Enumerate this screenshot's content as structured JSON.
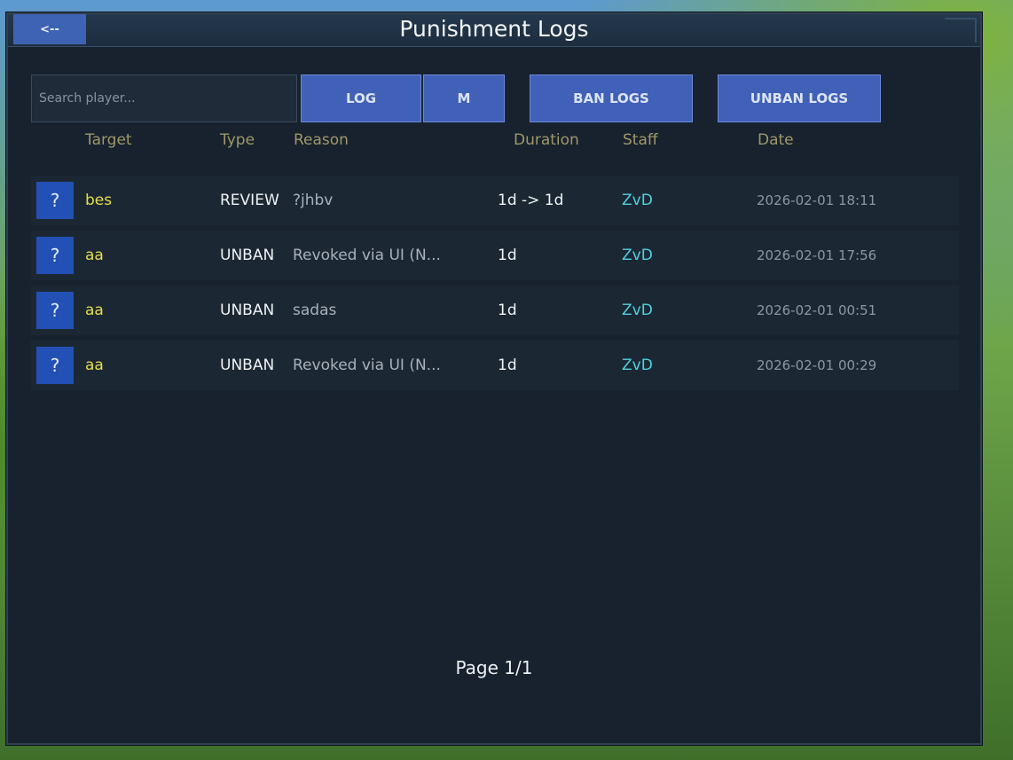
{
  "window": {
    "title": "Punishment Logs",
    "back_label": "<--"
  },
  "toolbar": {
    "search_placeholder": "Search player...",
    "log_label": "LOG",
    "m_label": "M",
    "ban_logs_label": "BAN LOGS",
    "unban_logs_label": "UNBAN LOGS"
  },
  "table": {
    "headers": {
      "target": "Target",
      "type": "Type",
      "reason": "Reason",
      "duration": "Duration",
      "staff": "Staff",
      "date": "Date"
    },
    "rows": [
      {
        "icon": "?",
        "target": "bes",
        "type": "REVIEW",
        "reason": "?jhbv",
        "duration": "1d -> 1d",
        "staff": "ZvD",
        "date": "2026-02-01 18:11"
      },
      {
        "icon": "?",
        "target": "aa",
        "type": "UNBAN",
        "reason": "Revoked via UI (N...",
        "duration": "1d",
        "staff": "ZvD",
        "date": "2026-02-01 17:56"
      },
      {
        "icon": "?",
        "target": "aa",
        "type": "UNBAN",
        "reason": "sadas",
        "duration": "1d",
        "staff": "ZvD",
        "date": "2026-02-01 00:51"
      },
      {
        "icon": "?",
        "target": "aa",
        "type": "UNBAN",
        "reason": "Revoked via UI (N...",
        "duration": "1d",
        "staff": "ZvD",
        "date": "2026-02-01 00:29"
      }
    ]
  },
  "pagination": {
    "label": "Page 1/1"
  },
  "colors": {
    "button": "#4160b8",
    "target_text": "#e6de4a",
    "staff_text": "#4fd1e0",
    "header_text": "#a0976a"
  }
}
